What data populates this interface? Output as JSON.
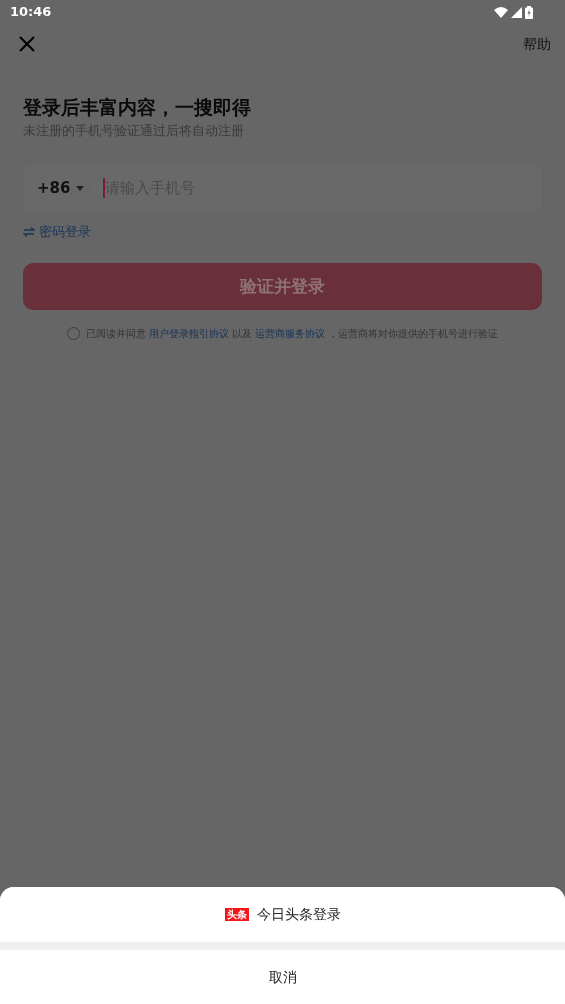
{
  "status_bar": {
    "time": "10:46"
  },
  "top_bar": {
    "help": "帮助"
  },
  "heading": "登录后丰富内容，一搜即得",
  "subtitle": "未注册的手机号验证通过后将自动注册",
  "phone_field": {
    "country_code": "+86",
    "placeholder": "请输入手机号",
    "focused": true
  },
  "password_login_link": "密码登录",
  "login_button": {
    "label": "验证并登录",
    "disabled": true
  },
  "agreement": {
    "checked": false,
    "parts": [
      {
        "kind": "text",
        "text": "已阅读并同意"
      },
      {
        "kind": "link",
        "text": "用户登录指引协议"
      },
      {
        "kind": "text",
        "text": "以及"
      },
      {
        "kind": "link",
        "text": "运营商服务协议"
      },
      {
        "kind": "text",
        "text": "，运营商将对你提供的手机号进行验证"
      }
    ]
  },
  "bottom_sheet": {
    "options": [
      {
        "logo_text": "头条",
        "label": "今日头条登录"
      }
    ],
    "cancel": "取消"
  }
}
